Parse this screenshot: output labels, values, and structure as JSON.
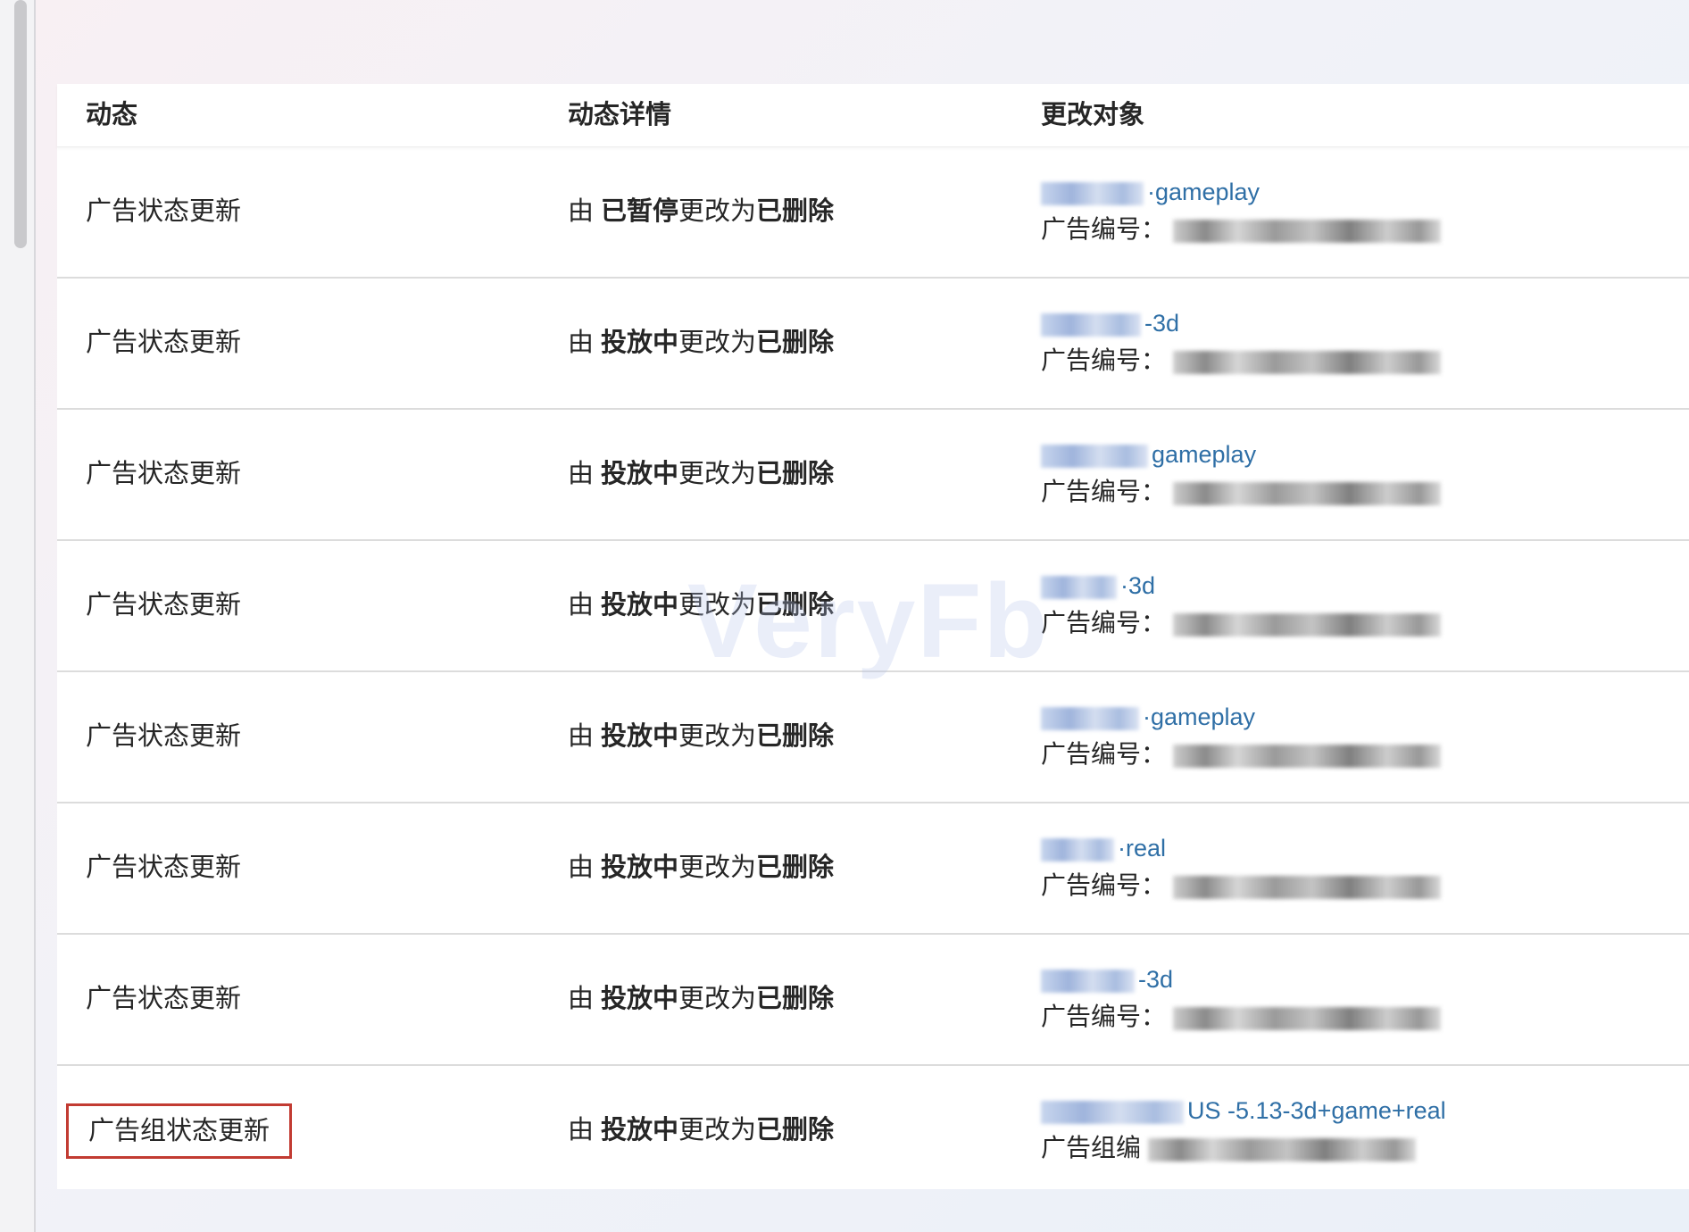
{
  "table": {
    "headers": {
      "action": "动态",
      "detail": "动态详情",
      "target": "更改对象"
    },
    "rows": [
      {
        "action": "广告状态更新",
        "detail_prefix": "由",
        "from_status": "已暂停",
        "change_text": "更改为",
        "to_status": "已删除",
        "target_name_suffix": "·gameplay",
        "target_id_label": "广告编号："
      },
      {
        "action": "广告状态更新",
        "detail_prefix": "由",
        "from_status": "投放中",
        "change_text": "更改为",
        "to_status": "已删除",
        "target_name_suffix": "-3d",
        "target_id_label": "广告编号："
      },
      {
        "action": "广告状态更新",
        "detail_prefix": "由",
        "from_status": "投放中",
        "change_text": "更改为",
        "to_status": "已删除",
        "target_name_suffix": "gameplay",
        "target_id_label": "广告编号："
      },
      {
        "action": "广告状态更新",
        "detail_prefix": "由",
        "from_status": "投放中",
        "change_text": "更改为",
        "to_status": "已删除",
        "target_name_suffix": "·3d",
        "target_id_label": "广告编号："
      },
      {
        "action": "广告状态更新",
        "detail_prefix": "由",
        "from_status": "投放中",
        "change_text": "更改为",
        "to_status": "已删除",
        "target_name_suffix": "·gameplay",
        "target_id_label": "广告编号："
      },
      {
        "action": "广告状态更新",
        "detail_prefix": "由",
        "from_status": "投放中",
        "change_text": "更改为",
        "to_status": "已删除",
        "target_name_suffix": "·real",
        "target_id_label": "广告编号："
      },
      {
        "action": "广告状态更新",
        "detail_prefix": "由",
        "from_status": "投放中",
        "change_text": "更改为",
        "to_status": "已删除",
        "target_name_suffix": "-3d",
        "target_id_label": "广告编号："
      },
      {
        "action": "广告组状态更新",
        "detail_prefix": "由",
        "from_status": "投放中",
        "change_text": "更改为",
        "to_status": "已删除",
        "target_name_suffix": "US -5.13-3d+game+real",
        "target_id_label": "广告组编"
      }
    ]
  },
  "watermark": "VeryFb",
  "colors": {
    "link": "#2f6fa6",
    "highlight_border": "#c23b32",
    "text": "#262626"
  }
}
